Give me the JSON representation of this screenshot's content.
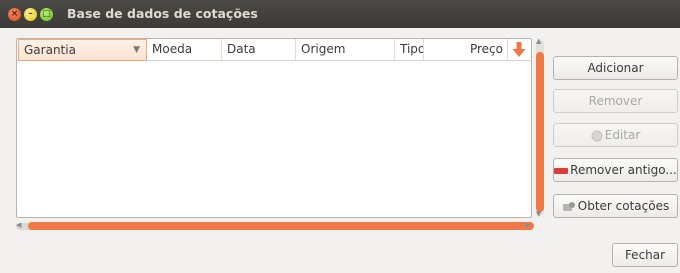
{
  "window": {
    "title": "Base de dados de cotações"
  },
  "table": {
    "columns": [
      "Garantia",
      "Moeda",
      "Data",
      "Origem",
      "Tipo",
      "Preço"
    ],
    "selected_column": "Garantia",
    "rows": []
  },
  "buttons": {
    "add": "Adicionar",
    "remove": "Remover",
    "edit": "Editar",
    "remove_old": "Remover antigo...",
    "get_quotes": "Obter cotações",
    "close": "Fechar"
  },
  "colors": {
    "accent": "#f07746",
    "titlebar": "#3c3b37"
  },
  "icons": {
    "sort": "sort-descending-arrow-icon",
    "edit": "edit-icon",
    "remove_old": "delete-old-icon",
    "get_quotes": "download-quotes-icon"
  }
}
